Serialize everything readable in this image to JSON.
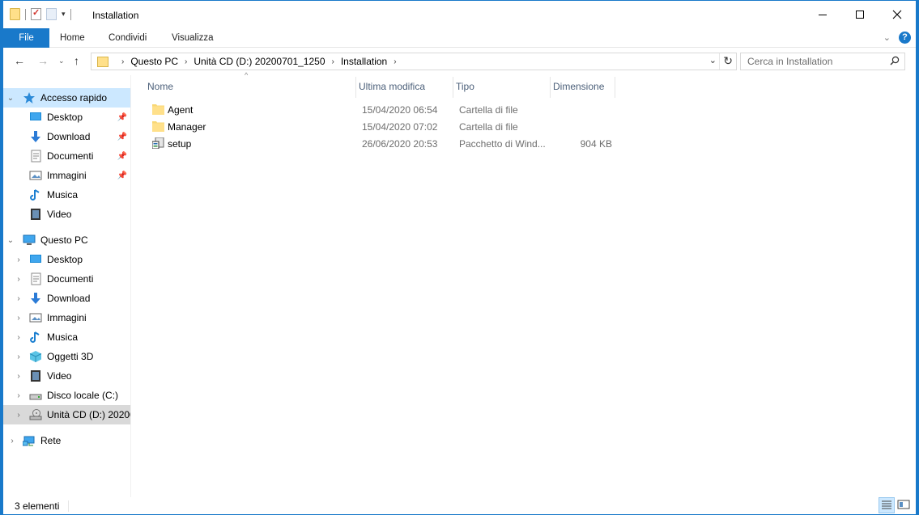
{
  "window": {
    "title": "Installation"
  },
  "ribbon": {
    "file": "File",
    "tabs": [
      "Home",
      "Condividi",
      "Visualizza"
    ]
  },
  "address": {
    "crumbs": [
      "Questo PC",
      "Unità CD (D:) 20200701_1250",
      "Installation"
    ]
  },
  "search": {
    "placeholder": "Cerca in Installation"
  },
  "nav": {
    "quick_access": "Accesso rapido",
    "quick_items": [
      "Desktop",
      "Download",
      "Documenti",
      "Immagini",
      "Musica",
      "Video"
    ],
    "this_pc": "Questo PC",
    "pc_items": [
      "Desktop",
      "Documenti",
      "Download",
      "Immagini",
      "Musica",
      "Oggetti 3D",
      "Video",
      "Disco locale (C:)",
      "Unità CD (D:) 20200"
    ],
    "network": "Rete"
  },
  "columns": {
    "name": "Nome",
    "modified": "Ultima modifica",
    "type": "Tipo",
    "size": "Dimensione"
  },
  "files": [
    {
      "name": "Agent",
      "modified": "15/04/2020 06:54",
      "type": "Cartella di file",
      "size": "",
      "icon": "folder-icon"
    },
    {
      "name": "Manager",
      "modified": "15/04/2020 07:02",
      "type": "Cartella di file",
      "size": "",
      "icon": "folder-icon"
    },
    {
      "name": "setup",
      "modified": "26/06/2020 20:53",
      "type": "Pacchetto di Wind...",
      "size": "904 KB",
      "icon": "installer-icon"
    }
  ],
  "status": {
    "count": "3 elementi"
  },
  "colors": {
    "accent": "#1979ca",
    "folder": "#ffe08a",
    "selected": "#cce8ff",
    "header_text": "#4c607a"
  }
}
